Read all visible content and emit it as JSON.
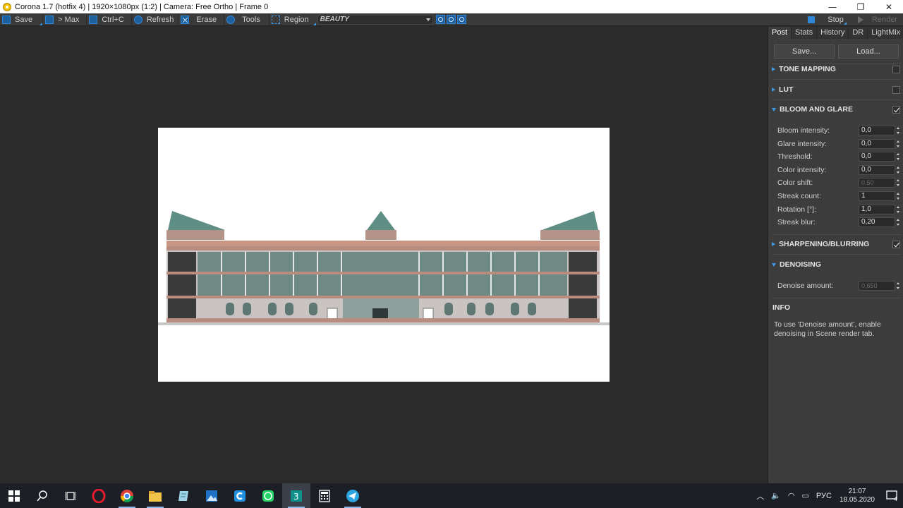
{
  "window": {
    "title": "Corona 1.7 (hotfix 4) | 1920×1080px (1:2) | Camera: Free Ortho | Frame 0",
    "minimize": "—",
    "maximize": "❐",
    "close": "✕"
  },
  "toolbar": {
    "save": "Save",
    "to_max": "> Max",
    "copy": "Ctrl+C",
    "refresh": "Refresh",
    "erase": "Erase",
    "tools": "Tools",
    "region": "Region",
    "pass": "BEAUTY",
    "stop": "Stop",
    "render": "Render"
  },
  "panel": {
    "tabs": [
      "Post",
      "Stats",
      "History",
      "DR",
      "LightMix"
    ],
    "active_tab": "Post",
    "save_btn": "Save...",
    "load_btn": "Load...",
    "sections": {
      "tone_mapping": {
        "label": "TONE MAPPING",
        "enabled": false,
        "expanded": false
      },
      "lut": {
        "label": "LUT",
        "enabled": false,
        "expanded": false
      },
      "bloom": {
        "label": "BLOOM AND GLARE",
        "enabled": true,
        "expanded": true
      },
      "sharpening": {
        "label": "SHARPENING/BLURRING",
        "enabled": true,
        "expanded": false
      },
      "denoising": {
        "label": "DENOISING",
        "expanded": true
      }
    },
    "bloom_params": [
      {
        "label": "Bloom intensity:",
        "value": "0,0"
      },
      {
        "label": "Glare intensity:",
        "value": "0,0"
      },
      {
        "label": "Threshold:",
        "value": "0,0"
      },
      {
        "label": "Color intensity:",
        "value": "0,0"
      },
      {
        "label": "Color shift:",
        "value": "0,50",
        "disabled": true
      },
      {
        "label": "Streak count:",
        "value": "1"
      },
      {
        "label": "Rotation [°]:",
        "value": "1,0"
      },
      {
        "label": "Streak blur:",
        "value": "0,20"
      }
    ],
    "denoise": {
      "label": "Denoise amount:",
      "value": "0,650",
      "disabled": true
    },
    "info_title": "INFO",
    "info_text": "To use 'Denoise amount', enable denoising in Scene render tab."
  },
  "taskbar": {
    "apps": [
      "windows-start",
      "search",
      "task-view",
      "opera",
      "chrome",
      "file-explorer",
      "notepad",
      "photos",
      "ccleaner",
      "whatsapp",
      "3ds-max",
      "calculator",
      "telegram"
    ],
    "language": "РУС",
    "time": "21:07",
    "date": "18.05.2020",
    "notifications": "4"
  },
  "colors": {
    "accent": "#2f86d6",
    "panel_bg": "#3c3c3c",
    "viewport_bg": "#2b2b2b",
    "taskbar_bg": "#1c1f26"
  }
}
